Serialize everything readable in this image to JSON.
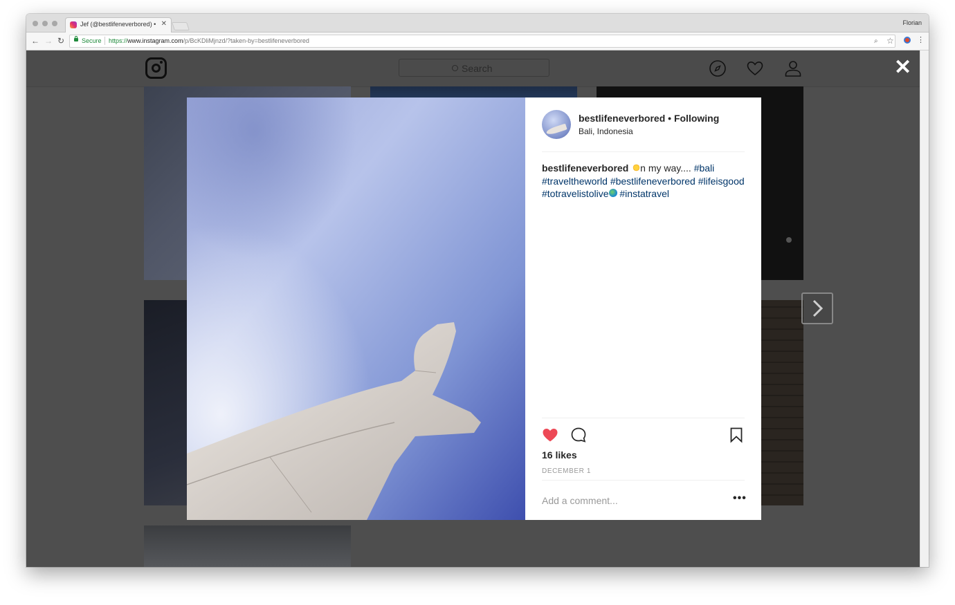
{
  "browser": {
    "tab_title": "Jef (@bestlifeneverbored) • In",
    "tab_close": "✕",
    "profile_name": "Florian",
    "secure_label": "Secure",
    "url_scheme": "https://",
    "url_host": "www.instagram.com",
    "url_path": "/p/BcKDliMjnzd/?taken-by=bestlifeneverbored",
    "back_icon": "←",
    "forward_icon": "→",
    "reload_icon": "↻",
    "zoom_icon": "⌕",
    "star_icon": "☆",
    "menu_icon": "⋮"
  },
  "instagram": {
    "search_placeholder": "Search",
    "close_glyph": "✕",
    "accent": "#ed4956",
    "link_color": "#003569"
  },
  "post": {
    "username": "bestlifeneverbored",
    "follow_separator": " • ",
    "follow_status": "Following",
    "location": "Bali, Indonesia",
    "caption": {
      "user": "bestlifeneverbored",
      "text_1": "n my way.... ",
      "tag_1": "#bali",
      "tag_2": "#traveltheworld",
      "tag_3": "#bestlifeneverbored",
      "tag_4": "#lifeisgood",
      "tag_5": "#totravelistolive",
      "tag_6": "#instatravel"
    },
    "liked": true,
    "likes": "16 likes",
    "date": "DECEMBER 1",
    "comment_placeholder": "Add a comment...",
    "more_glyph": "•••"
  }
}
